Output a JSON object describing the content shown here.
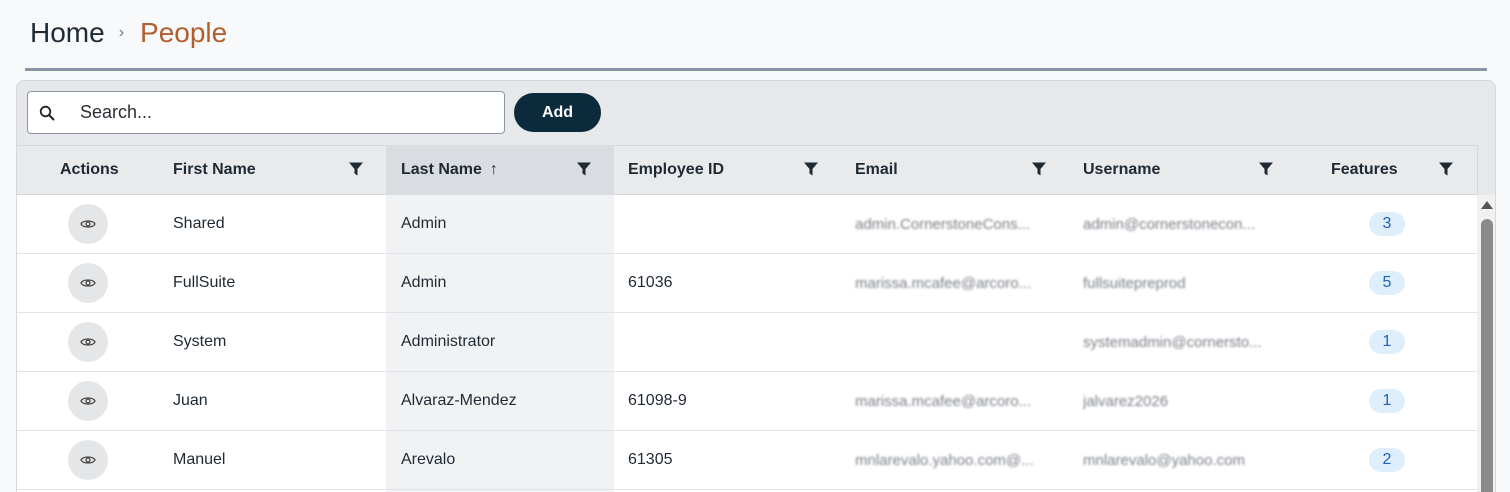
{
  "breadcrumb": {
    "home": "Home",
    "separator": "›",
    "current": "People"
  },
  "toolbar": {
    "search_placeholder": "Search...",
    "search_value": "",
    "add_label": "Add"
  },
  "columns": {
    "actions": "Actions",
    "first_name": "First Name",
    "last_name": "Last Name",
    "last_name_sort": "↑",
    "employee_id": "Employee ID",
    "email": "Email",
    "username": "Username",
    "features": "Features"
  },
  "rows": [
    {
      "first_name": "Shared",
      "last_name": "Admin",
      "employee_id": "",
      "email": "admin.CornerstoneCons...",
      "username": "admin@cornerstonecon...",
      "features": "3"
    },
    {
      "first_name": "FullSuite",
      "last_name": "Admin",
      "employee_id": "61036",
      "email": "marissa.mcafee@arcoro...",
      "username": "fullsuitepreprod",
      "features": "5"
    },
    {
      "first_name": "System",
      "last_name": "Administrator",
      "employee_id": "",
      "email": "",
      "username": "systemadmin@cornersto...",
      "features": "1"
    },
    {
      "first_name": "Juan",
      "last_name": "Alvaraz-Mendez",
      "employee_id": "61098-9",
      "email": "marissa.mcafee@arcoro...",
      "username": "jalvarez2026",
      "features": "1"
    },
    {
      "first_name": "Manuel",
      "last_name": "Arevalo",
      "employee_id": "61305",
      "email": "mnlarevalo.yahoo.com@...",
      "username": "mnlarevalo@yahoo.com",
      "features": "2"
    }
  ],
  "icons": {
    "search": "search-icon",
    "filter": "filter-icon",
    "view": "eye-icon"
  },
  "colors": {
    "accent_breadcrumb": "#b25e2e",
    "add_button": "#0b2a3c",
    "badge_bg": "#dfeefb",
    "badge_text": "#1d63b8"
  }
}
